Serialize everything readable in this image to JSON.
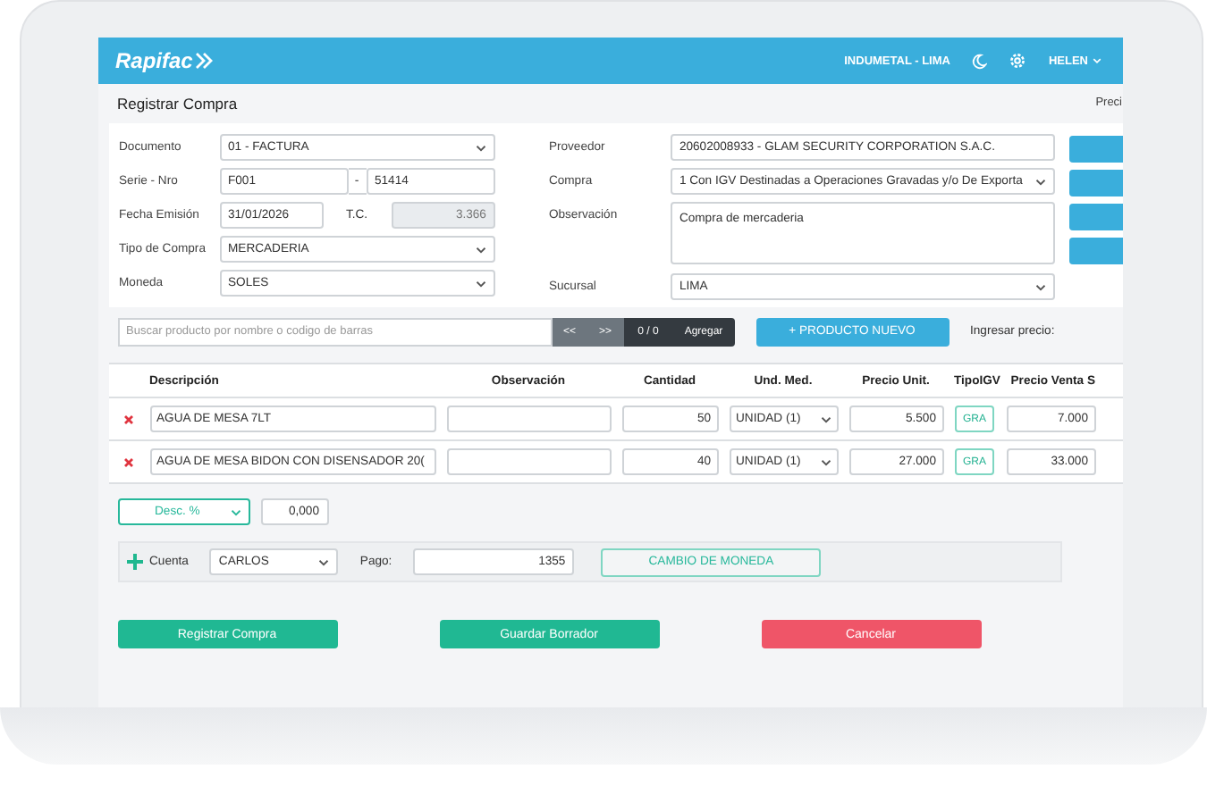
{
  "header": {
    "logo": "Rapifac",
    "company": "INDUMETAL - LIMA",
    "user": "HELEN"
  },
  "page": {
    "title": "Registrar Compra",
    "side_label": "Preci"
  },
  "form_left": [
    {
      "kind": "select",
      "label": "Documento",
      "value": "01 - FACTURA"
    },
    {
      "kind": "serie",
      "label": "Serie - Nro",
      "value": "F001",
      "separator": "-",
      "number": "51414"
    },
    {
      "kind": "date",
      "label": "Fecha Emisión",
      "value": "31/01/2026",
      "tc_label": "T.C.",
      "tc_value": "3.366",
      "tc_disabled": true
    },
    {
      "kind": "select",
      "label": "Tipo de Compra",
      "value": "MERCADERIA"
    },
    {
      "kind": "select",
      "label": "Moneda",
      "value": "SOLES"
    }
  ],
  "form_right": [
    {
      "kind": "text",
      "label": "Proveedor",
      "value": "20602008933 - GLAM SECURITY CORPORATION S.A.C."
    },
    {
      "kind": "select",
      "label": "Compra",
      "value": "1 Con IGV Destinadas a Operaciones Gravadas y/o De Exporta"
    },
    {
      "kind": "textarea",
      "label": "Observación",
      "value": "Compra de mercaderia"
    },
    {
      "kind": "select",
      "label": "Sucursal",
      "value": "LIMA"
    }
  ],
  "search": {
    "placeholder": "Buscar producto por nombre o codigo de barras",
    "prev": "<<",
    "next": ">>",
    "count": "0 / 0",
    "add": "Agregar",
    "new_product": "+ PRODUCTO NUEVO",
    "price_label": "Ingresar precio:"
  },
  "table": {
    "columns": [
      "Descripción",
      "Observación",
      "Cantidad",
      "Und. Med.",
      "Precio Unit.",
      "TipoIGV",
      "Precio Venta S"
    ],
    "rows": [
      {
        "description": "AGUA DE MESA 7LT",
        "quantity": "50",
        "unit": "UNIDAD (1)",
        "unit_price": "5.500",
        "igv": "GRA",
        "sale_price": "7.000"
      },
      {
        "description": "AGUA DE MESA BIDON CON DISENSADOR 20(",
        "quantity": "40",
        "unit": "UNIDAD (1)",
        "unit_price": "27.000",
        "igv": "GRA",
        "sale_price": "33.000"
      }
    ]
  },
  "discount": {
    "type": "Desc. %",
    "value": "0,000"
  },
  "payment": {
    "account_label": "Cuenta",
    "account": "CARLOS",
    "pay_label": "Pago:",
    "pay": "1355",
    "currency_button": "CAMBIO DE MONEDA"
  },
  "actions": [
    {
      "kind": "primary",
      "label": "Registrar Compra"
    },
    {
      "kind": "primary",
      "label": "Guardar Borrador"
    },
    {
      "kind": "danger",
      "label": "Cancelar"
    }
  ]
}
